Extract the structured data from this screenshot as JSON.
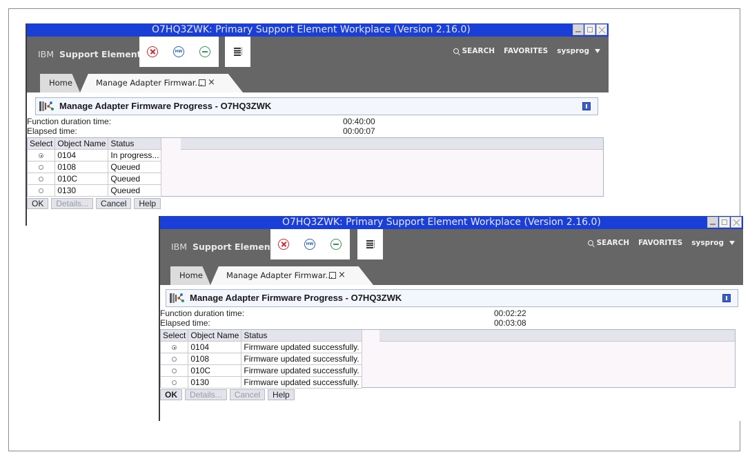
{
  "windows": [
    {
      "title": "O7HQ3ZWK: Primary Support Element Workplace (Version 2.16.0)",
      "brand": {
        "ibm": "IBM",
        "product": "Support Element"
      },
      "toolbar_icons": [
        "stop-icon",
        "hw-icon",
        "minus-circle-icon",
        "task-menu-icon"
      ],
      "hw_icon_text": "HW",
      "header_right": {
        "search": "SEARCH",
        "favorites": "FAVORITES",
        "user": "sysprog"
      },
      "tabs": {
        "home": "Home",
        "active": "Manage Adapter Firmwar..."
      },
      "panel_title": "Manage Adapter Firmware Progress - O7HQ3ZWK",
      "function_duration_label": "Function duration time:",
      "function_duration_value": "00:40:00",
      "elapsed_label": "Elapsed time:",
      "elapsed_value": "00:00:07",
      "columns": [
        "Select",
        "Object Name",
        "Status"
      ],
      "rows": [
        {
          "name": "0104",
          "status": "In progress...",
          "selected": true
        },
        {
          "name": "0108",
          "status": "Queued",
          "selected": false
        },
        {
          "name": "010C",
          "status": "Queued",
          "selected": false
        },
        {
          "name": "0130",
          "status": "Queued",
          "selected": false
        }
      ],
      "buttons": {
        "ok": "OK",
        "details": "Details...",
        "cancel": "Cancel",
        "help": "Help"
      }
    },
    {
      "title": "O7HQ3ZWK: Primary Support Element Workplace (Version 2.16.0)",
      "brand": {
        "ibm": "IBM",
        "product": "Support Element"
      },
      "toolbar_icons": [
        "stop-icon",
        "hw-icon",
        "minus-circle-icon",
        "task-menu-icon"
      ],
      "hw_icon_text": "HW",
      "header_right": {
        "search": "SEARCH",
        "favorites": "FAVORITES",
        "user": "sysprog"
      },
      "tabs": {
        "home": "Home",
        "active": "Manage Adapter Firmwar..."
      },
      "panel_title": "Manage Adapter Firmware Progress - O7HQ3ZWK",
      "function_duration_label": "Function duration time:",
      "function_duration_value": "00:02:22",
      "elapsed_label": "Elapsed time:",
      "elapsed_value": "00:03:08",
      "columns": [
        "Select",
        "Object Name",
        "Status"
      ],
      "rows": [
        {
          "name": "0104",
          "status": "Firmware updated successfully.",
          "selected": true
        },
        {
          "name": "0108",
          "status": "Firmware updated successfully.",
          "selected": false
        },
        {
          "name": "010C",
          "status": "Firmware updated successfully.",
          "selected": false
        },
        {
          "name": "0130",
          "status": "Firmware updated successfully.",
          "selected": false
        }
      ],
      "buttons": {
        "ok": "OK",
        "details": "Details...",
        "cancel": "Cancel",
        "help": "Help"
      }
    }
  ],
  "colors": {
    "titlebar": "#1a3fd6",
    "header": "#666666",
    "stop": "#d7262e",
    "hw": "#2563c9",
    "minus": "#2e9a56"
  }
}
